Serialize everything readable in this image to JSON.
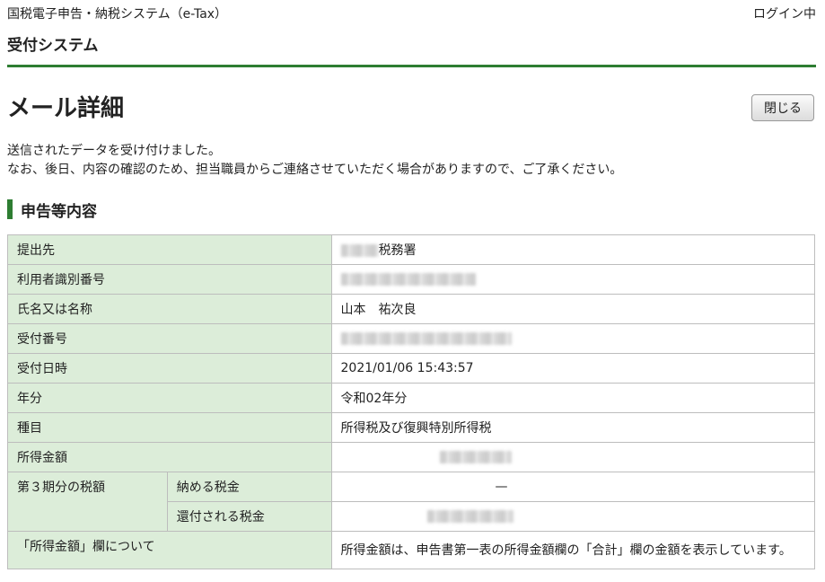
{
  "header": {
    "system_title": "国税電子申告・納税システム（e-Tax）",
    "login_status": "ログイン中",
    "subsystem": "受付システム"
  },
  "page": {
    "title": "メール詳細",
    "close_label": "閉じる",
    "message_line1": "送信されたデータを受け付けました。",
    "message_line2": "なお、後日、内容の確認のため、担当職員からご連絡させていただく場合がありますので、ご了承ください。"
  },
  "section": {
    "title": "申告等内容"
  },
  "table": {
    "submit_to_label": "提出先",
    "submit_to_suffix": "税務署",
    "user_id_label": "利用者識別番号",
    "name_label": "氏名又は名称",
    "name_value": "山本　祐次良",
    "receipt_no_label": "受付番号",
    "receipt_date_label": "受付日時",
    "receipt_date_value": "2021/01/06 15:43:57",
    "year_label": "年分",
    "year_value": "令和02年分",
    "type_label": "種目",
    "type_value": "所得税及び復興特別所得税",
    "income_label": "所得金額",
    "tax3_label": "第３期分の税額",
    "tax_pay_label": "納める税金",
    "tax_pay_value": "—",
    "tax_refund_label": "還付される税金",
    "note_label": "「所得金額」欄について",
    "note_value": "所得金額は、申告書第一表の所得金額欄の「合計」欄の金額を表示しています。"
  }
}
